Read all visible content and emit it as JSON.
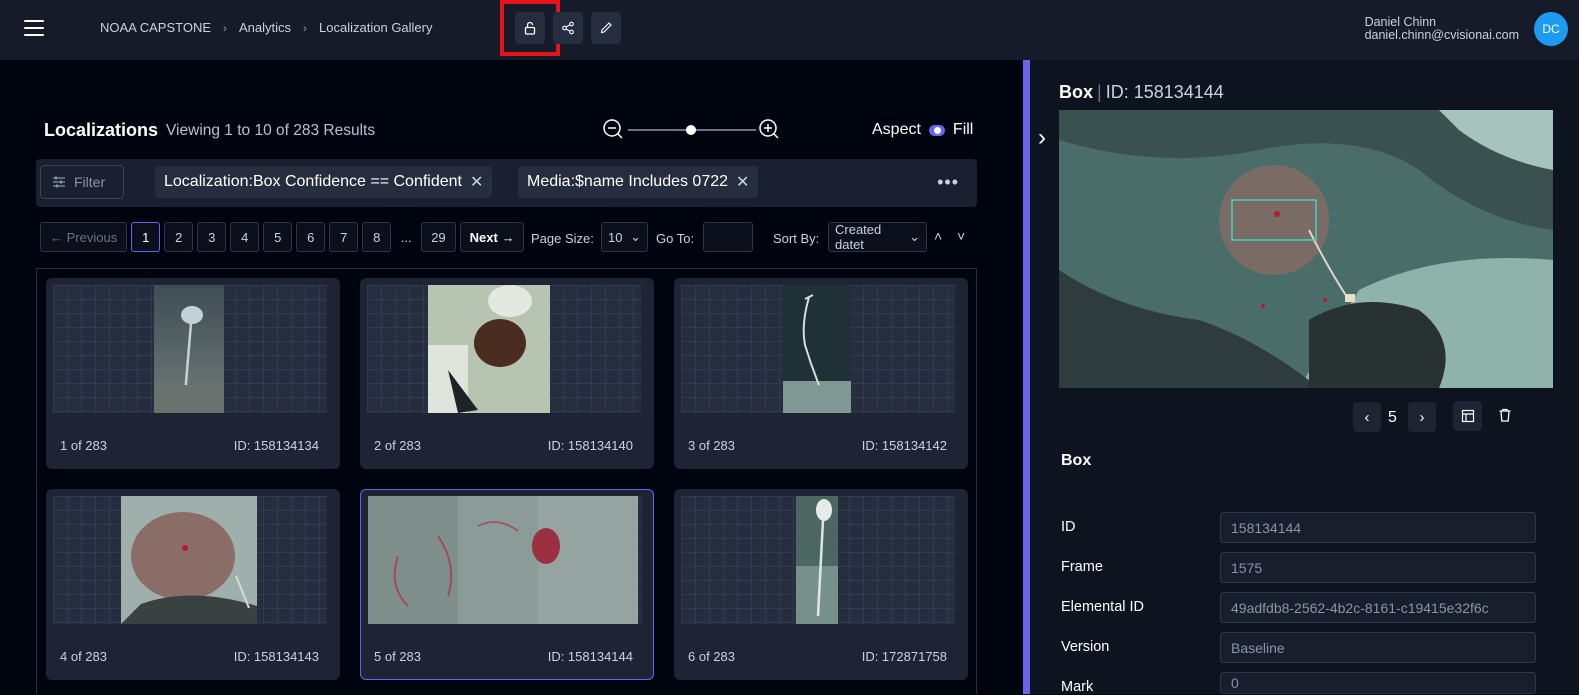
{
  "breadcrumb": [
    "NOAA CAPSTONE",
    "Analytics",
    "Localization Gallery"
  ],
  "user": {
    "name": "Daniel Chinn",
    "email": "daniel.chinn@cvisionai.com",
    "initials": "DC"
  },
  "colors": {
    "accent": "#6366f1",
    "divider": "#6c63e8",
    "highlight": "#e5141a",
    "avatar": "#1d9bf0"
  },
  "gallery": {
    "title": "Localizations",
    "subtitle": "Viewing 1 to 10 of 283 Results",
    "aspect_label": "Aspect",
    "fill_label": "Fill",
    "filter_label": "Filter",
    "chips": [
      "Localization:Box Confidence == Confident",
      "Media:$name Includes 0722"
    ]
  },
  "pager": {
    "previous": "Previous",
    "next": "Next",
    "pages": [
      "1",
      "2",
      "3",
      "4",
      "5",
      "6",
      "7",
      "8",
      "...",
      "29"
    ],
    "current": "1",
    "page_size_label": "Page Size:",
    "page_size": "10",
    "goto_label": "Go To:",
    "goto_value": "",
    "sort_label": "Sort By:",
    "sort_value": "Created datet"
  },
  "cards": [
    {
      "index": "1 of 283",
      "id": "ID: 158134134"
    },
    {
      "index": "2 of 283",
      "id": "ID: 158134140"
    },
    {
      "index": "3 of 283",
      "id": "ID: 158134142"
    },
    {
      "index": "4 of 283",
      "id": "ID: 158134143"
    },
    {
      "index": "5 of 283",
      "id": "ID: 158134144"
    },
    {
      "index": "6 of 283",
      "id": "ID: 172871758"
    }
  ],
  "panel": {
    "type": "Box",
    "id_label": "ID: 158134144",
    "frame_nav": "5",
    "section": "Box",
    "fields": [
      {
        "label": "ID",
        "value": "158134144"
      },
      {
        "label": "Frame",
        "value": "1575"
      },
      {
        "label": "Elemental ID",
        "value": "49adfdb8-2562-4b2c-8161-c19415e32f6c"
      },
      {
        "label": "Version",
        "value": "Baseline"
      },
      {
        "label": "Mark",
        "value": "0"
      }
    ]
  }
}
